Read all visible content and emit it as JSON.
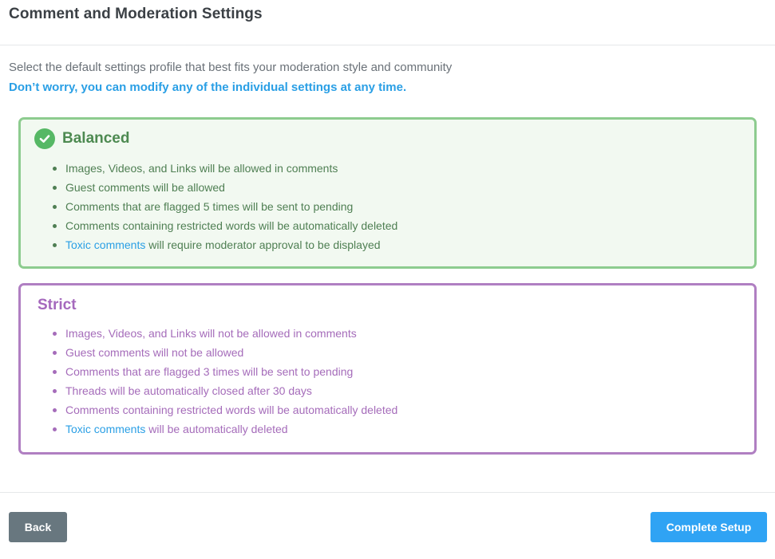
{
  "header": {
    "title": "Comment and Moderation Settings"
  },
  "intro": {
    "line": "Select the default settings profile that best fits your moderation style and community",
    "note": "Don’t worry, you can modify any of the individual settings at any time."
  },
  "profiles": {
    "balanced": {
      "title": "Balanced",
      "selected": true,
      "items": [
        "Images, Videos, and Links will be allowed in comments",
        "Guest comments will be allowed",
        "Comments that are flagged 5 times will be sent to pending",
        "Comments containing restricted words will be automatically deleted"
      ],
      "toxic_link": "Toxic comments",
      "toxic_rest": " will require moderator approval to be displayed"
    },
    "strict": {
      "title": "Strict",
      "selected": false,
      "items": [
        "Images, Videos, and Links will not be allowed in comments",
        "Guest comments will not be allowed",
        "Comments that are flagged 3 times will be sent to pending",
        "Threads will be automatically closed after 30 days",
        "Comments containing restricted words will be automatically deleted"
      ],
      "toxic_link": "Toxic comments",
      "toxic_rest": " will be automatically deleted"
    }
  },
  "footer": {
    "back_label": "Back",
    "complete_label": "Complete Setup"
  },
  "colors": {
    "accent": "#2fa3f4",
    "balanced_border": "#8dcc8f",
    "strict_border": "#b07fc2",
    "back_button": "#68777f"
  },
  "icons": {
    "balanced_selected": "check-circle-icon"
  }
}
